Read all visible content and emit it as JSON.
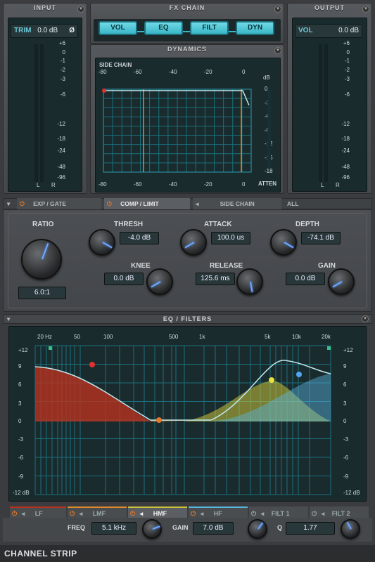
{
  "input": {
    "title": "INPUT",
    "trim_label": "TRIM",
    "trim_value": "0.0 dB",
    "phase_symbol": "Ø",
    "scale": [
      "+6",
      "0",
      "-1",
      "-2",
      "-3",
      "-6",
      "-12",
      "-18",
      "-24",
      "-48",
      "-96"
    ],
    "l": "L",
    "r": "R"
  },
  "fx": {
    "title": "FX CHAIN",
    "buttons": [
      "VOL",
      "EQ",
      "FILT",
      "DYN"
    ]
  },
  "output": {
    "title": "OUTPUT",
    "vol_label": "VOL",
    "vol_value": "0.0 dB",
    "scale": [
      "+6",
      "0",
      "-1",
      "-2",
      "-3",
      "-6",
      "-12",
      "-18",
      "-24",
      "-48",
      "-96"
    ],
    "l": "L",
    "r": "R"
  },
  "dynamics": {
    "title": "DYNAMICS",
    "side_chain": "SIDE CHAIN",
    "db": "dB",
    "atten": "ATTEN",
    "top_axis": [
      "-80",
      "-60",
      "-40",
      "-20",
      "0"
    ],
    "bottom_axis": [
      "-80",
      "-60",
      "-40",
      "-20",
      "0"
    ],
    "right_axis": [
      "0",
      "-3",
      "-6",
      "-9",
      "-12",
      "-15",
      "-18"
    ]
  },
  "tabs": {
    "exp_gate": "EXP / GATE",
    "comp_limit": "COMP / LIMIT",
    "side_chain": "SIDE CHAIN",
    "all": "ALL"
  },
  "comp": {
    "ratio_label": "RATIO",
    "ratio_value": "6.0:1",
    "thresh_label": "THRESH",
    "thresh_value": "-4.0 dB",
    "knee_label": "KNEE",
    "knee_value": "0.0 dB",
    "attack_label": "ATTACK",
    "attack_value": "100.0 us",
    "release_label": "RELEASE",
    "release_value": "125.6 ms",
    "depth_label": "DEPTH",
    "depth_value": "-74.1 dB",
    "gain_label": "GAIN",
    "gain_value": "0.0 dB"
  },
  "eq": {
    "title": "EQ / FILTERS",
    "freq_axis": [
      "20 Hz",
      "50",
      "100",
      "500",
      "1k",
      "5k",
      "10k",
      "20k"
    ],
    "left_db": [
      "+12",
      "9",
      "6",
      "3",
      "0",
      "-3",
      "-6",
      "-9",
      "-12 dB"
    ],
    "right_db": [
      "+12",
      "9",
      "6",
      "3",
      "0",
      "-3",
      "-6",
      "-9",
      "-12 dB"
    ],
    "bands": [
      "LF",
      "LMF",
      "HMF",
      "HF",
      "FILT 1",
      "FILT 2"
    ],
    "freq_label": "FREQ",
    "freq_value": "5.1 kHz",
    "gain_label": "GAIN",
    "gain_value": "7.0 dB",
    "q_label": "Q",
    "q_value": "1.77",
    "colors": {
      "lf": "#b8321e",
      "lmf": "#e08a2a",
      "hmf": "#c9c23a",
      "hf": "#58b6e0"
    }
  },
  "footer": {
    "title": "CHANNEL STRIP"
  }
}
